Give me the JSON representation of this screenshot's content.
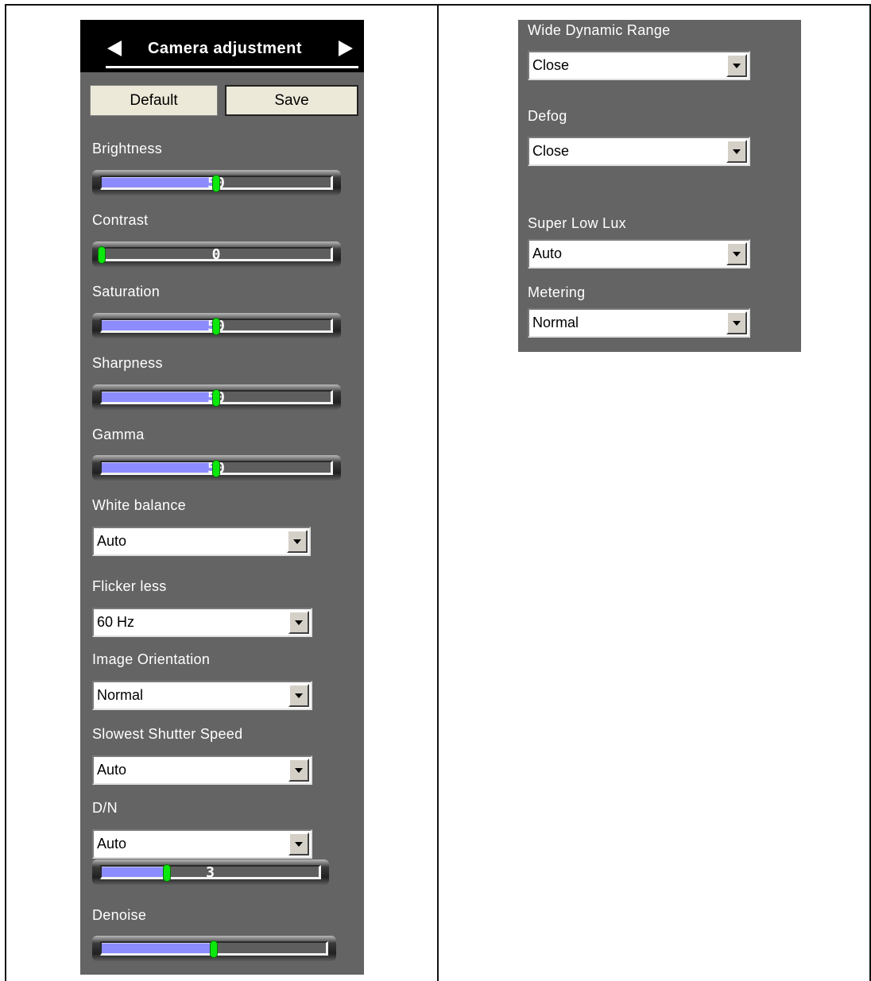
{
  "camera_panel": {
    "title": "Camera adjustment",
    "default_label": "Default",
    "save_label": "Save",
    "sliders": [
      {
        "label": "Brightness",
        "value": "50",
        "fraction": 0.5
      },
      {
        "label": "Contrast",
        "value": "0",
        "fraction": 0.0
      },
      {
        "label": "Saturation",
        "value": "50",
        "fraction": 0.5
      },
      {
        "label": "Sharpness",
        "value": "50",
        "fraction": 0.5
      },
      {
        "label": "Gamma",
        "value": "50",
        "fraction": 0.5
      }
    ],
    "white_balance": {
      "label": "White balance",
      "value": "Auto"
    },
    "flicker_less": {
      "label": "Flicker less",
      "value": "60 Hz"
    },
    "image_orientation": {
      "label": "Image Orientation",
      "value": "Normal"
    },
    "slowest_shutter_speed": {
      "label": "Slowest Shutter Speed",
      "value": "Auto"
    },
    "dn": {
      "label": "D/N",
      "value": "Auto",
      "slider_value": "3",
      "slider_fraction": 0.3
    },
    "denoise": {
      "label": "Denoise",
      "value": "5",
      "fraction": 0.5
    }
  },
  "right_panel": {
    "wide_dynamic_range": {
      "label": "Wide Dynamic Range",
      "value": "Close"
    },
    "defog": {
      "label": "Defog",
      "value": "Close"
    },
    "super_low_lux": {
      "label": "Super Low Lux",
      "value": "Auto"
    },
    "metering": {
      "label": "Metering",
      "value": "Normal"
    }
  },
  "colors": {
    "panel_bg": "#646464",
    "slider_fill": "#8c8cff",
    "slider_thumb": "#0be80b"
  }
}
